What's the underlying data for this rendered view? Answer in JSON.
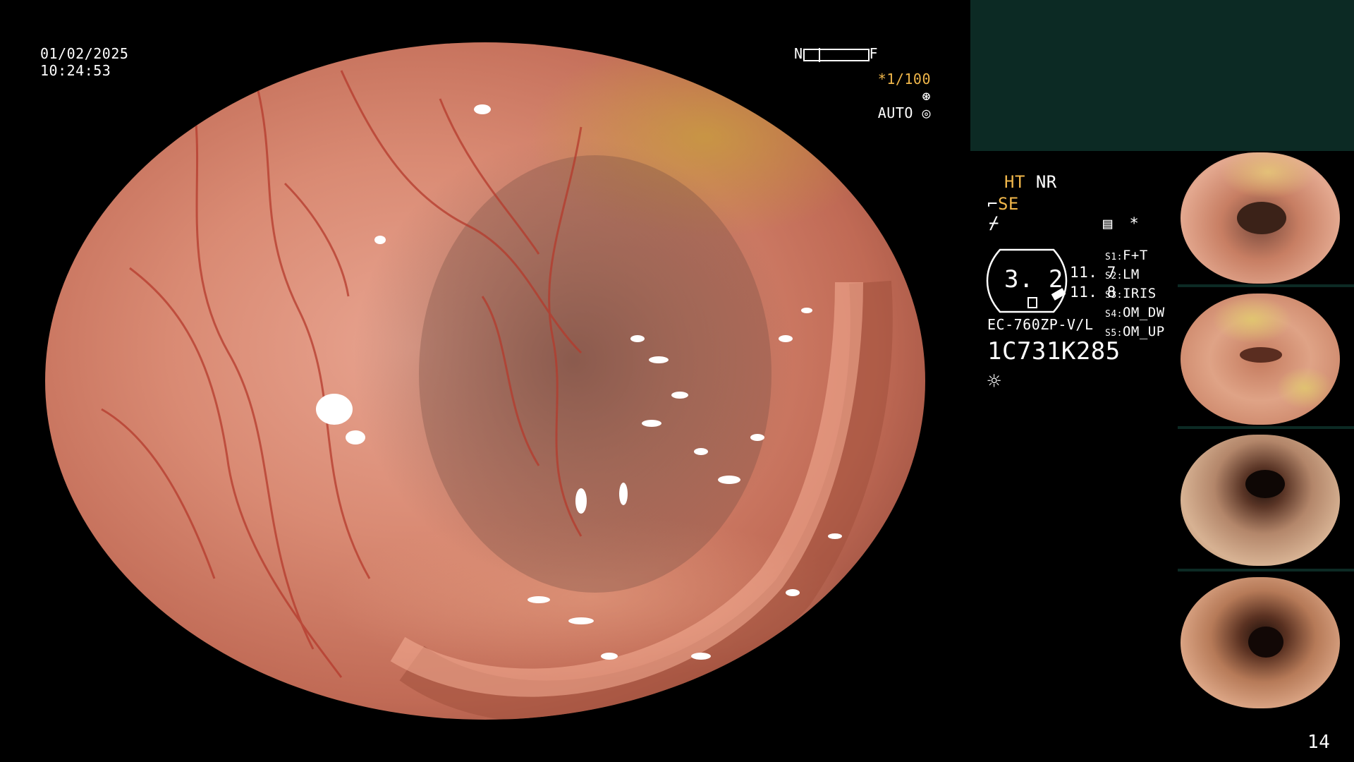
{
  "osd": {
    "date": "01/02/2025",
    "time": "10:24:53",
    "scale_near": "N",
    "scale_far": "F",
    "shutter": "*1/100",
    "shutter_icon": "aperture-icon",
    "exposure": "AUTO",
    "exposure_icon": "iris-icon"
  },
  "settings": {
    "ht": "HT",
    "nr": "NR",
    "se": "SE",
    "zoom_value": "3. 2",
    "reading_1": "11. 7",
    "reading_2": "11. 8",
    "scope_model": "EC-760ZP-V/L",
    "serial": "1C731K285",
    "s_labels": [
      "S1:",
      "S2:",
      "S3:",
      "S4:",
      "S5:"
    ],
    "s_values": [
      "F+T",
      "LM",
      "IRIS",
      "OM_DW",
      "OM_UP"
    ],
    "asterisk": "*"
  },
  "page_number": "14",
  "colors": {
    "amber": "#f0b64a",
    "panel_teal": "#0c2a24",
    "tissue": "#d98a73"
  }
}
